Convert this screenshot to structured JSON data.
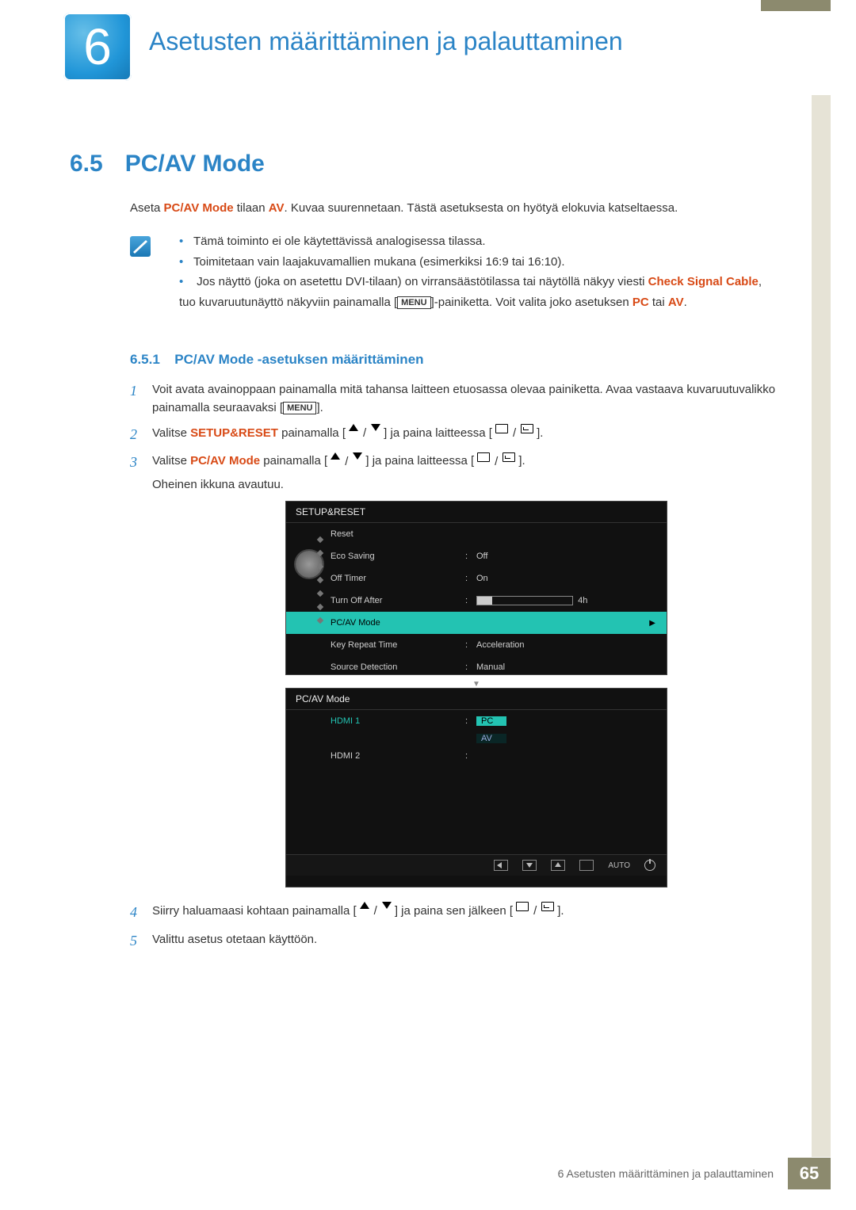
{
  "chapter": {
    "number": "6",
    "title": "Asetusten määrittäminen ja palauttaminen"
  },
  "section": {
    "number": "6.5",
    "title": "PC/AV Mode"
  },
  "intro": {
    "pre": "Aseta ",
    "em1": "PC/AV Mode",
    "mid": " tilaan ",
    "em2": "AV",
    "post": ". Kuvaa suurennetaan. Tästä asetuksesta on hyötyä elokuvia katseltaessa."
  },
  "notes": {
    "b1": "Tämä toiminto ei ole käytettävissä analogisessa tilassa.",
    "b2": "Toimitetaan vain laajakuvamallien mukana (esimerkiksi 16:9 tai 16:10).",
    "b3_a": "Jos näyttö (joka on asetettu DVI-tilaan) on virransäästötilassa tai näytöllä näkyy viesti ",
    "b3_em1": "Check Signal Cable",
    "b3_b": ", tuo kuvaruutunäyttö näkyviin painamalla [",
    "b3_menu": "MENU",
    "b3_c": "]-painiketta. Voit valita joko asetuksen ",
    "b3_em2": "PC",
    "b3_d": " tai ",
    "b3_em3": "AV",
    "b3_e": "."
  },
  "subsection": {
    "number": "6.5.1",
    "title": "PC/AV Mode -asetuksen määrittäminen"
  },
  "steps": {
    "s1_a": "Voit avata avainoppaan painamalla mitä tahansa laitteen etuosassa olevaa painiketta. Avaa vastaava kuvaruutuvalikko painamalla seuraavaksi [",
    "s1_menu": "MENU",
    "s1_b": "].",
    "s2_a": "Valitse ",
    "s2_em": "SETUP&RESET",
    "s2_b": " painamalla [",
    "s2_c": "] ja paina laitteessa [",
    "s2_d": "].",
    "s3_a": "Valitse ",
    "s3_em": "PC/AV Mode",
    "s3_b": " painamalla [",
    "s3_c": "] ja paina laitteessa [",
    "s3_d": "].",
    "s3_sub": "Oheinen ikkuna avautuu.",
    "s4_a": "Siirry haluamaasi kohtaan painamalla [",
    "s4_b": "] ja paina sen jälkeen [",
    "s4_c": "].",
    "s5": "Valittu asetus otetaan käyttöön."
  },
  "osd1": {
    "title": "SETUP&RESET",
    "rows": {
      "reset": "Reset",
      "eco": "Eco Saving",
      "eco_v": "Off",
      "offt": "Off Timer",
      "offt_v": "On",
      "turn": "Turn Off After",
      "turn_v": "4h",
      "turn_fill_pct": 16,
      "pcav": "PC/AV Mode",
      "key": "Key Repeat Time",
      "key_v": "Acceleration",
      "src": "Source Detection",
      "src_v": "Manual"
    },
    "auto": "AUTO"
  },
  "osd2": {
    "title": "PC/AV Mode",
    "hdmi1": "HDMI 1",
    "hdmi2": "HDMI 2",
    "pc": "PC",
    "av": "AV",
    "auto": "AUTO"
  },
  "footer": {
    "text": "6 Asetusten määrittäminen ja palauttaminen",
    "page": "65"
  }
}
